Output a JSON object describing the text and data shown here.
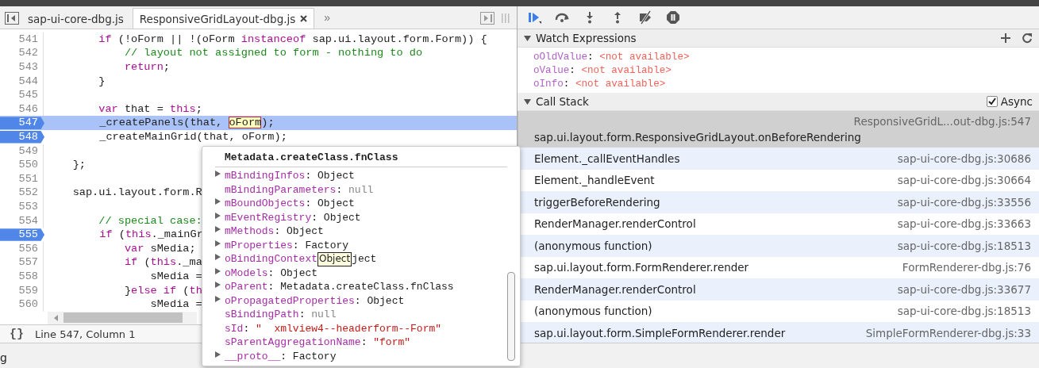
{
  "editor": {
    "tabs": [
      {
        "label": "sap-ui-core-dbg.js",
        "selected": false,
        "closable": false
      },
      {
        "label": "ResponsiveGridLayout-dbg.js",
        "selected": true,
        "closable": true
      }
    ],
    "overflow": "»",
    "lines": [
      {
        "number": "541",
        "selected": false,
        "breakpoint": false,
        "tokens": [
          {
            "text": "        if",
            "kind": "keyword"
          },
          {
            "text": " (!oForm || !(oForm ",
            "kind": "plain"
          },
          {
            "text": "instanceof",
            "kind": "keyword"
          },
          {
            "text": " sap.ui.layout.form.Form)) {",
            "kind": "plain"
          }
        ]
      },
      {
        "number": "542",
        "selected": false,
        "breakpoint": false,
        "tokens": [
          {
            "text": "            // layout not assigned to form - nothing to do",
            "kind": "comment"
          }
        ]
      },
      {
        "number": "543",
        "selected": false,
        "breakpoint": false,
        "tokens": [
          {
            "text": "            return",
            "kind": "keyword"
          },
          {
            "text": ";",
            "kind": "plain"
          }
        ]
      },
      {
        "number": "544",
        "selected": false,
        "breakpoint": false,
        "tokens": [
          {
            "text": "        }",
            "kind": "plain"
          }
        ]
      },
      {
        "number": "545",
        "selected": false,
        "breakpoint": false
      },
      {
        "number": "546",
        "selected": false,
        "breakpoint": false,
        "tokens": [
          {
            "text": "        var",
            "kind": "keyword"
          },
          {
            "text": " that = ",
            "kind": "plain"
          },
          {
            "text": "this",
            "kind": "keyword"
          },
          {
            "text": ";",
            "kind": "plain"
          }
        ]
      },
      {
        "number": "547",
        "selected": true,
        "breakpoint": true,
        "tokens": [
          {
            "text": "        _createPanels(that, ",
            "kind": "plain"
          },
          {
            "text": "oForm",
            "kind": "hover"
          },
          {
            "text": ");",
            "kind": "plain"
          }
        ]
      },
      {
        "number": "548",
        "selected": false,
        "breakpoint": true,
        "tokens": [
          {
            "text": "        _createMainGrid(that, oForm);",
            "kind": "plain"
          }
        ]
      },
      {
        "number": "549",
        "selected": false,
        "breakpoint": false
      },
      {
        "number": "550",
        "selected": false,
        "breakpoint": false,
        "tokens": [
          {
            "text": "    };",
            "kind": "plain"
          }
        ]
      },
      {
        "number": "551",
        "selected": false,
        "breakpoint": false
      },
      {
        "number": "552",
        "selected": false,
        "breakpoint": false,
        "tokens": [
          {
            "text": "    sap.ui.layout.form.R",
            "kind": "plain"
          }
        ]
      },
      {
        "number": "553",
        "selected": false,
        "breakpoint": false
      },
      {
        "number": "554",
        "selected": false,
        "breakpoint": false,
        "tokens": [
          {
            "text": "        // special case:",
            "kind": "comment"
          }
        ]
      },
      {
        "number": "555",
        "selected": false,
        "breakpoint": true,
        "tokens": [
          {
            "text": "        if",
            "kind": "keyword"
          },
          {
            "text": " (",
            "kind": "plain"
          },
          {
            "text": "this",
            "kind": "keyword"
          },
          {
            "text": "._mainGr",
            "kind": "plain"
          }
        ]
      },
      {
        "number": "556",
        "selected": false,
        "breakpoint": false,
        "tokens": [
          {
            "text": "            var",
            "kind": "keyword"
          },
          {
            "text": " sMedia;",
            "kind": "plain"
          }
        ]
      },
      {
        "number": "557",
        "selected": false,
        "breakpoint": false,
        "tokens": [
          {
            "text": "            if",
            "kind": "keyword"
          },
          {
            "text": " (",
            "kind": "plain"
          },
          {
            "text": "this",
            "kind": "keyword"
          },
          {
            "text": "._ma",
            "kind": "plain"
          }
        ]
      },
      {
        "number": "558",
        "selected": false,
        "breakpoint": false,
        "tokens": [
          {
            "text": "                sMedia =",
            "kind": "plain"
          }
        ]
      },
      {
        "number": "559",
        "selected": false,
        "breakpoint": false,
        "tokens": [
          {
            "text": "            }",
            "kind": "plain"
          },
          {
            "text": "else if",
            "kind": "keyword"
          },
          {
            "text": " (",
            "kind": "plain"
          },
          {
            "text": "th",
            "kind": "keyword"
          }
        ]
      },
      {
        "number": "560",
        "selected": false,
        "breakpoint": false,
        "tokens": [
          {
            "text": "                sMedia =",
            "kind": "plain"
          }
        ]
      }
    ],
    "status": "Line 547, Column 1",
    "format_button": "{}"
  },
  "popover": {
    "title": "Metadata.createClass.fnClass",
    "properties": [
      {
        "name": "mBindingInfos",
        "sep": ":",
        "value": "Object",
        "kind": "object",
        "expandable": true
      },
      {
        "name": "mBindingParameters",
        "sep": ":",
        "value": "null",
        "kind": "null",
        "expandable": false
      },
      {
        "name": "mBoundObjects",
        "sep": ":",
        "value": "Object",
        "kind": "object",
        "expandable": true
      },
      {
        "name": "mEventRegistry",
        "sep": ":",
        "value": "Object",
        "kind": "object",
        "expandable": true
      },
      {
        "name": "mMethods",
        "sep": ":",
        "value": "Object",
        "kind": "object",
        "expandable": true
      },
      {
        "name": "mProperties",
        "sep": ":",
        "value": "Factory",
        "kind": "object",
        "expandable": true
      },
      {
        "name": "oBindingContext",
        "value": "ject",
        "kind": "object",
        "expandable": true,
        "tooltip": "Object"
      },
      {
        "name": "oModels",
        "sep": ":",
        "value": "Object",
        "kind": "object",
        "expandable": true
      },
      {
        "name": "oParent",
        "sep": ":",
        "value": "Metadata.createClass.fnClass",
        "kind": "object",
        "expandable": true
      },
      {
        "name": "oPropagatedProperties",
        "sep": ":",
        "value": "Object",
        "kind": "object",
        "expandable": true
      },
      {
        "name": "sBindingPath",
        "sep": ":",
        "value": "null",
        "kind": "null",
        "expandable": false
      },
      {
        "name": "sId",
        "sep": ":",
        "value": "\"  xmlview4--headerform--Form\"",
        "kind": "string",
        "expandable": false
      },
      {
        "name": "sParentAggregationName",
        "sep": ":",
        "value": "\"form\"",
        "kind": "string",
        "expandable": false
      },
      {
        "name": "__proto__",
        "sep": ":",
        "value": "Factory",
        "kind": "object",
        "expandable": true
      }
    ]
  },
  "debugger": {
    "toolbar": [
      {
        "kind": "resume"
      },
      {
        "kind": "step-over"
      },
      {
        "kind": "step-into"
      },
      {
        "kind": "step-out"
      },
      {
        "kind": "deactivate"
      },
      {
        "kind": "pause"
      }
    ],
    "watch": {
      "title": "Watch Expressions",
      "expanded": true,
      "items": [
        {
          "name": "oOldValue",
          "sep": ":",
          "value": "<not available>"
        },
        {
          "name": "oValue",
          "sep": ":",
          "value": "<not available>"
        },
        {
          "name": "oInfo",
          "sep": ":",
          "value": "<not available>"
        }
      ]
    },
    "call_stack": {
      "title": "Call Stack",
      "expanded": true,
      "async_label": "Async",
      "async": true,
      "frames": [
        {
          "name": "sap.ui.layout.form.ResponsiveGridLayout.onBeforeRendering",
          "location": "ResponsiveGridL...out-dbg.js:547",
          "selected": true
        },
        {
          "name": "Element._callEventHandles",
          "location": "sap-ui-core-dbg.js:30686",
          "selected": false
        },
        {
          "name": "Element._handleEvent",
          "location": "sap-ui-core-dbg.js:30664",
          "selected": false
        },
        {
          "name": "triggerBeforeRendering",
          "location": "sap-ui-core-dbg.js:33556",
          "selected": false
        },
        {
          "name": "RenderManager.renderControl",
          "location": "sap-ui-core-dbg.js:33663",
          "selected": false
        },
        {
          "name": "(anonymous function)",
          "location": "sap-ui-core-dbg.js:18513",
          "selected": false
        },
        {
          "name": "sap.ui.layout.form.FormRenderer.render",
          "location": "FormRenderer-dbg.js:76",
          "selected": false
        },
        {
          "name": "RenderManager.renderControl",
          "location": "sap-ui-core-dbg.js:33677",
          "selected": false
        },
        {
          "name": "(anonymous function)",
          "location": "sap-ui-core-dbg.js:18513",
          "selected": false
        },
        {
          "name": "sap.ui.layout.form.SimpleFormRenderer.render",
          "location": "SimpleFormRenderer-dbg.js:33",
          "selected": false
        }
      ]
    }
  },
  "drawer": {
    "text": "g"
  }
}
